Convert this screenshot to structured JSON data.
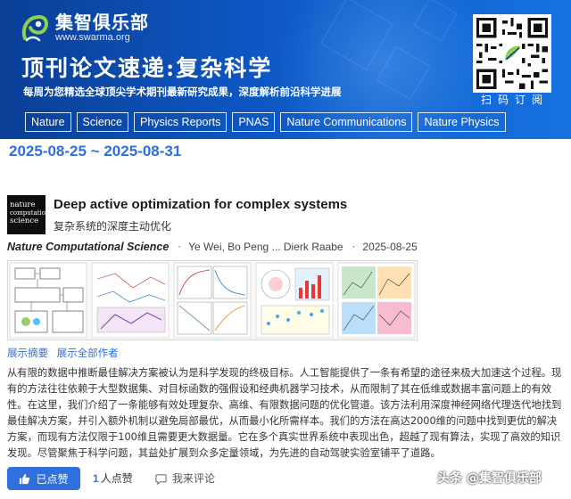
{
  "banner": {
    "brand": "集智俱乐部",
    "url": "www.swarma.org",
    "headline": "顶刊论文速递:复杂科学",
    "subline": "每周为您精选全球顶尖学术期刊最新研究成果，深度解析前沿科学进展",
    "qr_caption": "扫码订阅",
    "journals": [
      "Nature",
      "Science",
      "Physics Reports",
      "PNAS",
      "Nature Communications",
      "Nature Physics"
    ]
  },
  "date_range": "2025-08-25 ~ 2025-08-31",
  "article": {
    "journal_logo_lines": [
      "nature",
      "computational",
      "science"
    ],
    "title": "Deep active optimization for complex systems",
    "title_cn": "复杂系统的深度主动优化",
    "journal": "Nature Computational Science",
    "authors": "Ye Wei,  Bo Peng ... Dierk Raabe",
    "date": "2025-08-25",
    "show_abstract": "展示摘要",
    "show_authors": "展示全部作者",
    "abstract": "从有限的数据中推断最佳解决方案被认为是科学发现的终极目标。人工智能提供了一条有希望的途径来极大加速这个过程。现有的方法往往依赖于大型数据集、对目标函数的强假设和经典机器学习技术，从而限制了其在低维或数据丰富问题上的有效性。在这里，我们介绍了一条能够有效处理复杂、高维、有限数据问题的优化管道。该方法利用深度神经网络代理迭代地找到最佳解决方案，并引入额外机制以避免局部最优，从而最小化所需样本。我们的方法在高达2000维的问题中找到更优的解决方案，而现有方法仅限于100维且需要更大数据量。它在多个真实世界系统中表现出色，超越了现有算法，实现了高效的知识发现。尽管聚焦于科学问题，其益处扩展到众多定量领域，为先进的自动驾驶实验室铺平了道路。"
  },
  "footer": {
    "like_label": "已点赞",
    "like_count": "1",
    "like_suffix": "人点赞",
    "comment_label": "我来评论",
    "watermark": "头条 @集智俱乐部"
  },
  "colors": {
    "banner_start": "#0a3f96",
    "banner_end": "#1672e0",
    "accent": "#2f6fde"
  }
}
